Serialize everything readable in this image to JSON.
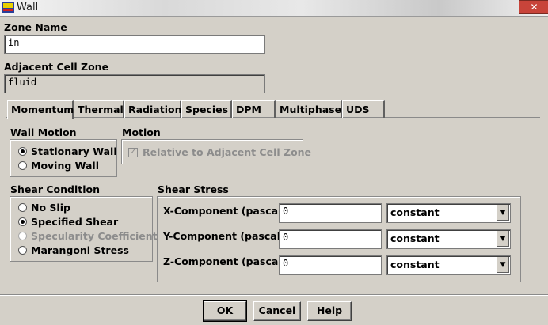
{
  "window": {
    "title": "Wall"
  },
  "zone_name": {
    "label": "Zone Name",
    "value": "in"
  },
  "adjacent_cell_zone": {
    "label": "Adjacent Cell Zone",
    "value": "fluid"
  },
  "tabs": [
    "Momentum",
    "Thermal",
    "Radiation",
    "Species",
    "DPM",
    "Multiphase",
    "UDS"
  ],
  "active_tab": "Momentum",
  "wall_motion": {
    "label": "Wall Motion",
    "options": [
      "Stationary Wall",
      "Moving Wall"
    ],
    "selected": "Stationary Wall"
  },
  "motion": {
    "label": "Motion",
    "checkbox_label": "Relative to Adjacent Cell Zone",
    "checked": true,
    "enabled": false
  },
  "shear_condition": {
    "label": "Shear Condition",
    "options": [
      "No Slip",
      "Specified Shear",
      "Specularity Coefficient",
      "Marangoni Stress"
    ],
    "selected": "Specified Shear"
  },
  "shear_stress": {
    "label": "Shear Stress",
    "rows": [
      {
        "label": "X-Component (pascal)",
        "value": "0",
        "method": "constant"
      },
      {
        "label": "Y-Component (pascal)",
        "value": "0",
        "method": "constant"
      },
      {
        "label": "Z-Component (pascal)",
        "value": "0",
        "method": "constant"
      }
    ]
  },
  "buttons": {
    "ok": "OK",
    "cancel": "Cancel",
    "help": "Help"
  },
  "colors": {
    "dialog_bg": "#d4d0c8",
    "field_bg": "#ffffff",
    "disabled_text": "#8c8c8c"
  }
}
